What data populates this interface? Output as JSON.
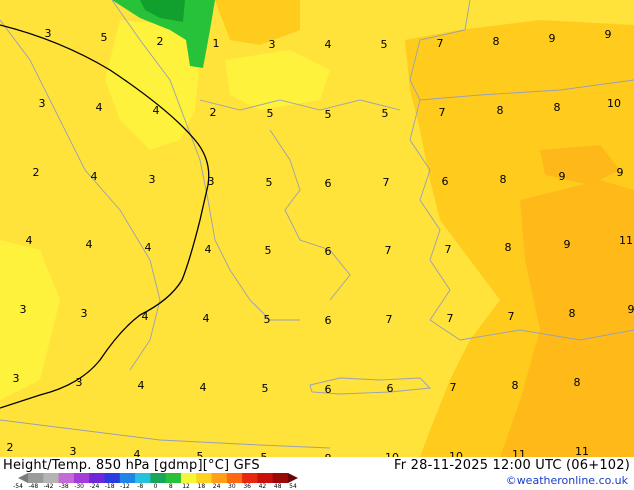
{
  "header": {
    "title_left": "Height/Temp. 850 hPa [gdmp][°C] GFS",
    "title_right": "Fr 28-11-2025 12:00 UTC (06+102)",
    "credit": "©weatheronline.co.uk"
  },
  "colorbar": {
    "labels": [
      "-54",
      "-48",
      "-42",
      "-38",
      "-30",
      "-24",
      "-18",
      "-12",
      "-8",
      "0",
      "8",
      "12",
      "18",
      "24",
      "30",
      "36",
      "42",
      "48",
      "54"
    ],
    "colors": [
      "#7a7a7a",
      "#9a9a9a",
      "#b4b4b4",
      "#c36ad6",
      "#a53bd9",
      "#6e28d6",
      "#2a3be0",
      "#1f86e8",
      "#25c2e0",
      "#1aa55a",
      "#28c23a",
      "#f5f53a",
      "#ffd21e",
      "#ffa016",
      "#ff6a10",
      "#e8280e",
      "#c8100c",
      "#9a0808",
      "#6a0404"
    ]
  },
  "map": {
    "background_color": "#ffe23a",
    "temperature_labels": [
      "3",
      "5",
      "2",
      "1",
      "3",
      "4",
      "5",
      "7",
      "8",
      "9",
      "9",
      "3",
      "4",
      "4",
      "2",
      "5",
      "5",
      "5",
      "7",
      "8",
      "8",
      "10",
      "2",
      "4",
      "3",
      "3",
      "5",
      "6",
      "7",
      "6",
      "8",
      "9",
      "9",
      "4",
      "4",
      "4",
      "4",
      "5",
      "6",
      "7",
      "7",
      "8",
      "9",
      "11",
      "3",
      "3",
      "4",
      "4",
      "5",
      "6",
      "7",
      "7",
      "7",
      "8",
      "9",
      "3",
      "3",
      "4",
      "4",
      "5",
      "6",
      "6",
      "7",
      "8",
      "8",
      "2",
      "3",
      "4",
      "5",
      "5",
      "8",
      "10",
      "10",
      "11",
      "11"
    ]
  }
}
